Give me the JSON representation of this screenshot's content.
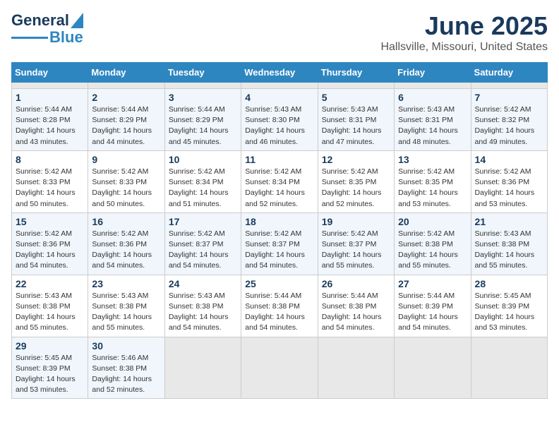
{
  "header": {
    "logo_general": "General",
    "logo_blue": "Blue",
    "month_title": "June 2025",
    "location": "Hallsville, Missouri, United States"
  },
  "calendar": {
    "days_of_week": [
      "Sunday",
      "Monday",
      "Tuesday",
      "Wednesday",
      "Thursday",
      "Friday",
      "Saturday"
    ],
    "weeks": [
      [
        {
          "day": "",
          "empty": true
        },
        {
          "day": "",
          "empty": true
        },
        {
          "day": "",
          "empty": true
        },
        {
          "day": "",
          "empty": true
        },
        {
          "day": "",
          "empty": true
        },
        {
          "day": "",
          "empty": true
        },
        {
          "day": "",
          "empty": true
        }
      ],
      [
        {
          "day": "1",
          "sunrise": "5:44 AM",
          "sunset": "8:28 PM",
          "daylight": "14 hours and 43 minutes."
        },
        {
          "day": "2",
          "sunrise": "5:44 AM",
          "sunset": "8:29 PM",
          "daylight": "14 hours and 44 minutes."
        },
        {
          "day": "3",
          "sunrise": "5:44 AM",
          "sunset": "8:29 PM",
          "daylight": "14 hours and 45 minutes."
        },
        {
          "day": "4",
          "sunrise": "5:43 AM",
          "sunset": "8:30 PM",
          "daylight": "14 hours and 46 minutes."
        },
        {
          "day": "5",
          "sunrise": "5:43 AM",
          "sunset": "8:31 PM",
          "daylight": "14 hours and 47 minutes."
        },
        {
          "day": "6",
          "sunrise": "5:43 AM",
          "sunset": "8:31 PM",
          "daylight": "14 hours and 48 minutes."
        },
        {
          "day": "7",
          "sunrise": "5:42 AM",
          "sunset": "8:32 PM",
          "daylight": "14 hours and 49 minutes."
        }
      ],
      [
        {
          "day": "8",
          "sunrise": "5:42 AM",
          "sunset": "8:33 PM",
          "daylight": "14 hours and 50 minutes."
        },
        {
          "day": "9",
          "sunrise": "5:42 AM",
          "sunset": "8:33 PM",
          "daylight": "14 hours and 50 minutes."
        },
        {
          "day": "10",
          "sunrise": "5:42 AM",
          "sunset": "8:34 PM",
          "daylight": "14 hours and 51 minutes."
        },
        {
          "day": "11",
          "sunrise": "5:42 AM",
          "sunset": "8:34 PM",
          "daylight": "14 hours and 52 minutes."
        },
        {
          "day": "12",
          "sunrise": "5:42 AM",
          "sunset": "8:35 PM",
          "daylight": "14 hours and 52 minutes."
        },
        {
          "day": "13",
          "sunrise": "5:42 AM",
          "sunset": "8:35 PM",
          "daylight": "14 hours and 53 minutes."
        },
        {
          "day": "14",
          "sunrise": "5:42 AM",
          "sunset": "8:36 PM",
          "daylight": "14 hours and 53 minutes."
        }
      ],
      [
        {
          "day": "15",
          "sunrise": "5:42 AM",
          "sunset": "8:36 PM",
          "daylight": "14 hours and 54 minutes."
        },
        {
          "day": "16",
          "sunrise": "5:42 AM",
          "sunset": "8:36 PM",
          "daylight": "14 hours and 54 minutes."
        },
        {
          "day": "17",
          "sunrise": "5:42 AM",
          "sunset": "8:37 PM",
          "daylight": "14 hours and 54 minutes."
        },
        {
          "day": "18",
          "sunrise": "5:42 AM",
          "sunset": "8:37 PM",
          "daylight": "14 hours and 54 minutes."
        },
        {
          "day": "19",
          "sunrise": "5:42 AM",
          "sunset": "8:37 PM",
          "daylight": "14 hours and 55 minutes."
        },
        {
          "day": "20",
          "sunrise": "5:42 AM",
          "sunset": "8:38 PM",
          "daylight": "14 hours and 55 minutes."
        },
        {
          "day": "21",
          "sunrise": "5:43 AM",
          "sunset": "8:38 PM",
          "daylight": "14 hours and 55 minutes."
        }
      ],
      [
        {
          "day": "22",
          "sunrise": "5:43 AM",
          "sunset": "8:38 PM",
          "daylight": "14 hours and 55 minutes."
        },
        {
          "day": "23",
          "sunrise": "5:43 AM",
          "sunset": "8:38 PM",
          "daylight": "14 hours and 55 minutes."
        },
        {
          "day": "24",
          "sunrise": "5:43 AM",
          "sunset": "8:38 PM",
          "daylight": "14 hours and 54 minutes."
        },
        {
          "day": "25",
          "sunrise": "5:44 AM",
          "sunset": "8:38 PM",
          "daylight": "14 hours and 54 minutes."
        },
        {
          "day": "26",
          "sunrise": "5:44 AM",
          "sunset": "8:38 PM",
          "daylight": "14 hours and 54 minutes."
        },
        {
          "day": "27",
          "sunrise": "5:44 AM",
          "sunset": "8:39 PM",
          "daylight": "14 hours and 54 minutes."
        },
        {
          "day": "28",
          "sunrise": "5:45 AM",
          "sunset": "8:39 PM",
          "daylight": "14 hours and 53 minutes."
        }
      ],
      [
        {
          "day": "29",
          "sunrise": "5:45 AM",
          "sunset": "8:39 PM",
          "daylight": "14 hours and 53 minutes."
        },
        {
          "day": "30",
          "sunrise": "5:46 AM",
          "sunset": "8:38 PM",
          "daylight": "14 hours and 52 minutes."
        },
        {
          "day": "",
          "empty": true
        },
        {
          "day": "",
          "empty": true
        },
        {
          "day": "",
          "empty": true
        },
        {
          "day": "",
          "empty": true
        },
        {
          "day": "",
          "empty": true
        }
      ]
    ]
  }
}
